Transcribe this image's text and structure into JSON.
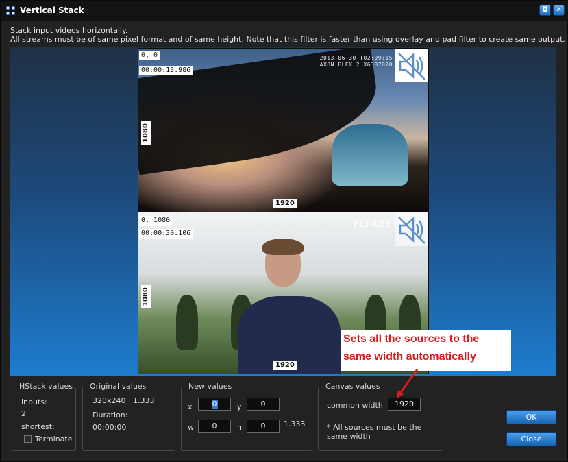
{
  "window": {
    "title": "Vertical Stack",
    "restore_glyph": "◘",
    "close_glyph": "✕"
  },
  "description": {
    "line1": "Stack input videos horizontally.",
    "line2": "All streams must be of same pixel format and of same height.  Note that this filter is faster than using overlay and pad filter to create same output."
  },
  "preview": {
    "top": {
      "position": "0, 0",
      "timestamp": "00:00:13.986",
      "height_label": "1080",
      "width_label": "1920",
      "cam_line1": "2013-06-30 T02:09:15",
      "cam_line2": "AXON FLEX 2 X6307B70",
      "mute_icon": "speaker-mute-icon"
    },
    "bottom": {
      "position": "0, 1080",
      "timestamp": "00:00:30.106",
      "height_label": "1080",
      "width_label": "1920",
      "watermark": "FLI-XBE",
      "mute_icon": "speaker-mute-icon"
    }
  },
  "annotation": {
    "line1": "Sets all the sources to the",
    "line2": "same width automatically",
    "color": "#d51e1e"
  },
  "hstack": {
    "title": "HStack values",
    "inputs_label": "inputs:",
    "inputs_value": "2",
    "shortest_label": "shortest:",
    "terminate_label": "Terminate"
  },
  "original": {
    "title": "Original values",
    "resolution": "320x240",
    "ratio": "1.333",
    "duration_label": "Duration:",
    "duration_value": "00:00:00"
  },
  "new_values": {
    "title": "New values",
    "x_label": "x",
    "x_value": "0",
    "y_label": "y",
    "y_value": "0",
    "w_label": "w",
    "w_value": "0",
    "h_label": "h",
    "h_value": "0",
    "ratio": "1.333"
  },
  "canvas": {
    "title": "Canvas values",
    "common_width_label": "common width",
    "common_width_value": "1920",
    "note_line1": "* All sources must be the",
    "note_line2": "same width"
  },
  "buttons": {
    "ok": "OK",
    "close": "Close"
  },
  "colors": {
    "accent": "#1f6fc4",
    "preview_gradient_bottom": "#1d7ccf"
  }
}
